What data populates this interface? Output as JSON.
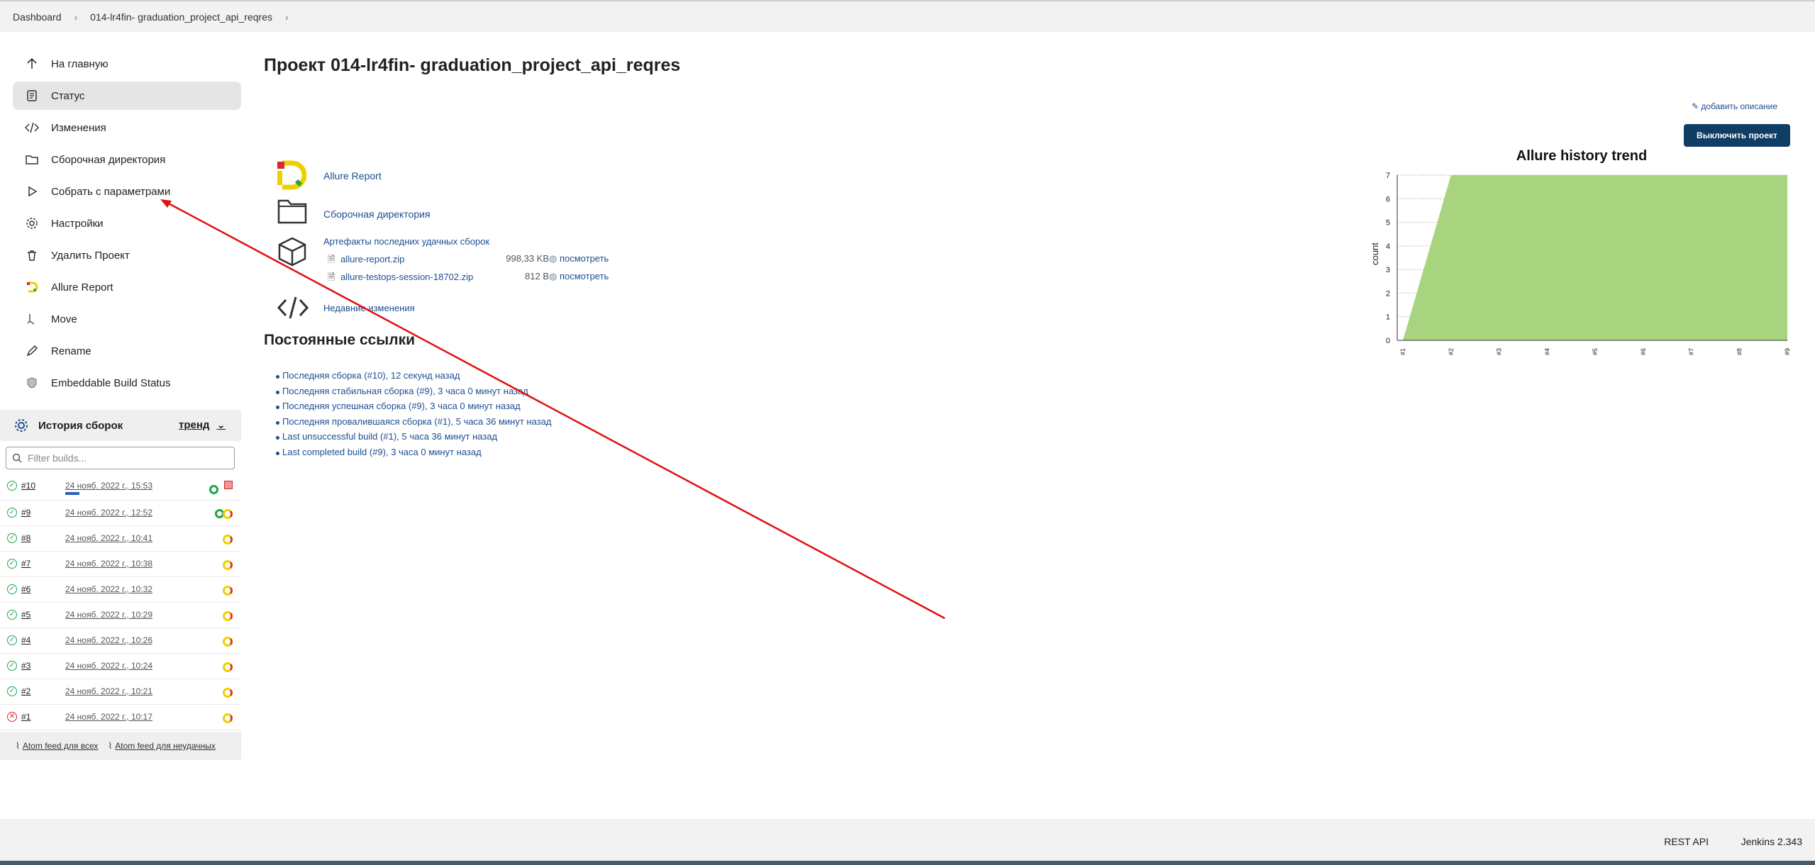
{
  "breadcrumbs": [
    "Dashboard",
    "014-lr4fin- graduation_project_api_reqres"
  ],
  "sidebar": {
    "items": [
      {
        "label": "На главную",
        "icon": "arrow-up-icon"
      },
      {
        "label": "Статус",
        "icon": "document-icon"
      },
      {
        "label": "Изменения",
        "icon": "code-icon"
      },
      {
        "label": "Сборочная директория",
        "icon": "folder-icon"
      },
      {
        "label": "Собрать с параметрами",
        "icon": "play-icon"
      },
      {
        "label": "Настройки",
        "icon": "gear-icon"
      },
      {
        "label": "Удалить Проект",
        "icon": "trash-icon"
      },
      {
        "label": "Allure Report",
        "icon": "allure-icon"
      },
      {
        "label": "Move",
        "icon": "move-icon"
      },
      {
        "label": "Rename",
        "icon": "pencil-icon"
      },
      {
        "label": "Embeddable Build Status",
        "icon": "shield-icon"
      }
    ]
  },
  "history": {
    "title": "История сборок",
    "trend": "тренд",
    "filter_placeholder": "Filter builds...",
    "builds": [
      {
        "num": "#10",
        "date": "24 нояб. 2022 г., 15:53"
      },
      {
        "num": "#9",
        "date": "24 нояб. 2022 г., 12:52"
      },
      {
        "num": "#8",
        "date": "24 нояб. 2022 г., 10:41"
      },
      {
        "num": "#7",
        "date": "24 нояб. 2022 г., 10:38"
      },
      {
        "num": "#6",
        "date": "24 нояб. 2022 г., 10:32"
      },
      {
        "num": "#5",
        "date": "24 нояб. 2022 г., 10:29"
      },
      {
        "num": "#4",
        "date": "24 нояб. 2022 г., 10:26"
      },
      {
        "num": "#3",
        "date": "24 нояб. 2022 г., 10:24"
      },
      {
        "num": "#2",
        "date": "24 нояб. 2022 г., 10:21"
      },
      {
        "num": "#1",
        "date": "24 нояб. 2022 г., 10:17"
      }
    ],
    "feed_all": "Atom feed для всех",
    "feed_fail": "Atom feed для неудачных"
  },
  "main": {
    "title": "Проект 014-lr4fin- graduation_project_api_reqres",
    "add_description": "добавить описание",
    "disable_button": "Выключить проект",
    "allure_link": "Allure Report",
    "workspace_link": "Сборочная директория",
    "artifacts_link": "Артефакты последних удачных сборок",
    "artifacts": [
      {
        "name": "allure-report.zip",
        "size": "998,33 KB",
        "view": "посмотреть"
      },
      {
        "name": "allure-testops-session-18702.zip",
        "size": "812 B",
        "view": "посмотреть"
      }
    ],
    "changes_link": "Недавние изменения",
    "permalinks_title": "Постоянные ссылки",
    "permalinks": [
      "Последняя сборка (#10), 12 секунд назад",
      "Последняя стабильная сборка (#9), 3 часа 0 минут назад",
      "Последняя успешная сборка (#9), 3 часа 0 минут назад",
      "Последняя провалившаяся сборка (#1), 5 часа 36 минут назад",
      "Last unsuccessful build (#1), 5 часа 36 минут назад",
      "Last completed build (#9), 3 часа 0 минут назад"
    ]
  },
  "footer": {
    "rest_api": "REST API",
    "version": "Jenkins 2.343"
  },
  "chart_data": {
    "type": "area",
    "title": "Allure history trend",
    "ylabel": "count",
    "xlabel": "",
    "categories": [
      "#1",
      "#2",
      "#3",
      "#4",
      "#5",
      "#6",
      "#7",
      "#8",
      "#9"
    ],
    "values": [
      0,
      7,
      7,
      7,
      7,
      7,
      7,
      7,
      7
    ],
    "ylim": [
      0,
      7
    ],
    "grid": true,
    "color": "#a9d47f"
  }
}
